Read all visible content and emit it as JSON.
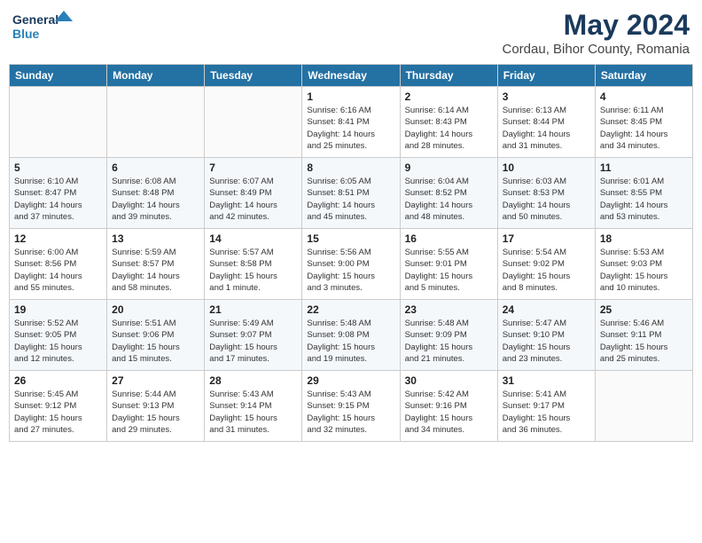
{
  "header": {
    "logo_line1": "General",
    "logo_line2": "Blue",
    "month": "May 2024",
    "location": "Cordau, Bihor County, Romania"
  },
  "weekdays": [
    "Sunday",
    "Monday",
    "Tuesday",
    "Wednesday",
    "Thursday",
    "Friday",
    "Saturday"
  ],
  "weeks": [
    [
      {
        "day": "",
        "info": ""
      },
      {
        "day": "",
        "info": ""
      },
      {
        "day": "",
        "info": ""
      },
      {
        "day": "1",
        "info": "Sunrise: 6:16 AM\nSunset: 8:41 PM\nDaylight: 14 hours\nand 25 minutes."
      },
      {
        "day": "2",
        "info": "Sunrise: 6:14 AM\nSunset: 8:43 PM\nDaylight: 14 hours\nand 28 minutes."
      },
      {
        "day": "3",
        "info": "Sunrise: 6:13 AM\nSunset: 8:44 PM\nDaylight: 14 hours\nand 31 minutes."
      },
      {
        "day": "4",
        "info": "Sunrise: 6:11 AM\nSunset: 8:45 PM\nDaylight: 14 hours\nand 34 minutes."
      }
    ],
    [
      {
        "day": "5",
        "info": "Sunrise: 6:10 AM\nSunset: 8:47 PM\nDaylight: 14 hours\nand 37 minutes."
      },
      {
        "day": "6",
        "info": "Sunrise: 6:08 AM\nSunset: 8:48 PM\nDaylight: 14 hours\nand 39 minutes."
      },
      {
        "day": "7",
        "info": "Sunrise: 6:07 AM\nSunset: 8:49 PM\nDaylight: 14 hours\nand 42 minutes."
      },
      {
        "day": "8",
        "info": "Sunrise: 6:05 AM\nSunset: 8:51 PM\nDaylight: 14 hours\nand 45 minutes."
      },
      {
        "day": "9",
        "info": "Sunrise: 6:04 AM\nSunset: 8:52 PM\nDaylight: 14 hours\nand 48 minutes."
      },
      {
        "day": "10",
        "info": "Sunrise: 6:03 AM\nSunset: 8:53 PM\nDaylight: 14 hours\nand 50 minutes."
      },
      {
        "day": "11",
        "info": "Sunrise: 6:01 AM\nSunset: 8:55 PM\nDaylight: 14 hours\nand 53 minutes."
      }
    ],
    [
      {
        "day": "12",
        "info": "Sunrise: 6:00 AM\nSunset: 8:56 PM\nDaylight: 14 hours\nand 55 minutes."
      },
      {
        "day": "13",
        "info": "Sunrise: 5:59 AM\nSunset: 8:57 PM\nDaylight: 14 hours\nand 58 minutes."
      },
      {
        "day": "14",
        "info": "Sunrise: 5:57 AM\nSunset: 8:58 PM\nDaylight: 15 hours\nand 1 minute."
      },
      {
        "day": "15",
        "info": "Sunrise: 5:56 AM\nSunset: 9:00 PM\nDaylight: 15 hours\nand 3 minutes."
      },
      {
        "day": "16",
        "info": "Sunrise: 5:55 AM\nSunset: 9:01 PM\nDaylight: 15 hours\nand 5 minutes."
      },
      {
        "day": "17",
        "info": "Sunrise: 5:54 AM\nSunset: 9:02 PM\nDaylight: 15 hours\nand 8 minutes."
      },
      {
        "day": "18",
        "info": "Sunrise: 5:53 AM\nSunset: 9:03 PM\nDaylight: 15 hours\nand 10 minutes."
      }
    ],
    [
      {
        "day": "19",
        "info": "Sunrise: 5:52 AM\nSunset: 9:05 PM\nDaylight: 15 hours\nand 12 minutes."
      },
      {
        "day": "20",
        "info": "Sunrise: 5:51 AM\nSunset: 9:06 PM\nDaylight: 15 hours\nand 15 minutes."
      },
      {
        "day": "21",
        "info": "Sunrise: 5:49 AM\nSunset: 9:07 PM\nDaylight: 15 hours\nand 17 minutes."
      },
      {
        "day": "22",
        "info": "Sunrise: 5:48 AM\nSunset: 9:08 PM\nDaylight: 15 hours\nand 19 minutes."
      },
      {
        "day": "23",
        "info": "Sunrise: 5:48 AM\nSunset: 9:09 PM\nDaylight: 15 hours\nand 21 minutes."
      },
      {
        "day": "24",
        "info": "Sunrise: 5:47 AM\nSunset: 9:10 PM\nDaylight: 15 hours\nand 23 minutes."
      },
      {
        "day": "25",
        "info": "Sunrise: 5:46 AM\nSunset: 9:11 PM\nDaylight: 15 hours\nand 25 minutes."
      }
    ],
    [
      {
        "day": "26",
        "info": "Sunrise: 5:45 AM\nSunset: 9:12 PM\nDaylight: 15 hours\nand 27 minutes."
      },
      {
        "day": "27",
        "info": "Sunrise: 5:44 AM\nSunset: 9:13 PM\nDaylight: 15 hours\nand 29 minutes."
      },
      {
        "day": "28",
        "info": "Sunrise: 5:43 AM\nSunset: 9:14 PM\nDaylight: 15 hours\nand 31 minutes."
      },
      {
        "day": "29",
        "info": "Sunrise: 5:43 AM\nSunset: 9:15 PM\nDaylight: 15 hours\nand 32 minutes."
      },
      {
        "day": "30",
        "info": "Sunrise: 5:42 AM\nSunset: 9:16 PM\nDaylight: 15 hours\nand 34 minutes."
      },
      {
        "day": "31",
        "info": "Sunrise: 5:41 AM\nSunset: 9:17 PM\nDaylight: 15 hours\nand 36 minutes."
      },
      {
        "day": "",
        "info": ""
      }
    ]
  ]
}
